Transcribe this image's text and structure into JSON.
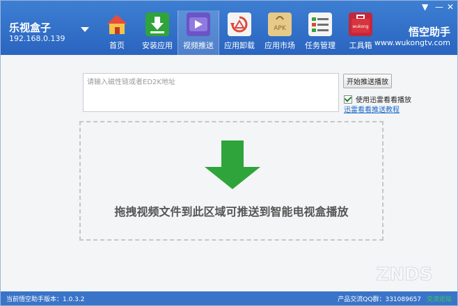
{
  "header": {
    "device_name": "乐视盒子",
    "device_ip": "192.168.0.139",
    "brand_name": "悟空助手",
    "brand_url": "www.wukongtv.com",
    "window_controls": {
      "menu": "▼",
      "minimize": "—",
      "close": "✕"
    }
  },
  "nav": {
    "items": [
      {
        "label": "首页",
        "icon": "home-icon"
      },
      {
        "label": "安装应用",
        "icon": "install-icon"
      },
      {
        "label": "视频推送",
        "icon": "video-push-icon",
        "active": true
      },
      {
        "label": "应用卸载",
        "icon": "uninstall-icon"
      },
      {
        "label": "应用市场",
        "icon": "apk-market-icon"
      },
      {
        "label": "任务管理",
        "icon": "task-manager-icon"
      },
      {
        "label": "工具箱",
        "icon": "toolbox-icon",
        "badge": "wukong"
      }
    ]
  },
  "push": {
    "input_placeholder": "请输入磁性链或者ED2K地址",
    "start_button": "开始推送播放",
    "xunlei_checkbox_label": "使用迅雷看看播放",
    "xunlei_checked": true,
    "xunlei_link": "迅雷看看推送教程",
    "drop_text": "拖拽视频文件到此区域可推送到智能电视盒播放"
  },
  "status": {
    "version": "当前悟空助手版本：1.0.3.2",
    "qq_group": "产品交流QQ群：331089657",
    "forum_link": "交流论坛"
  },
  "watermark": "ZNDS",
  "colors": {
    "header": "#2f6fcb",
    "accent_green": "#2fa43a",
    "link": "#1b69c8"
  }
}
